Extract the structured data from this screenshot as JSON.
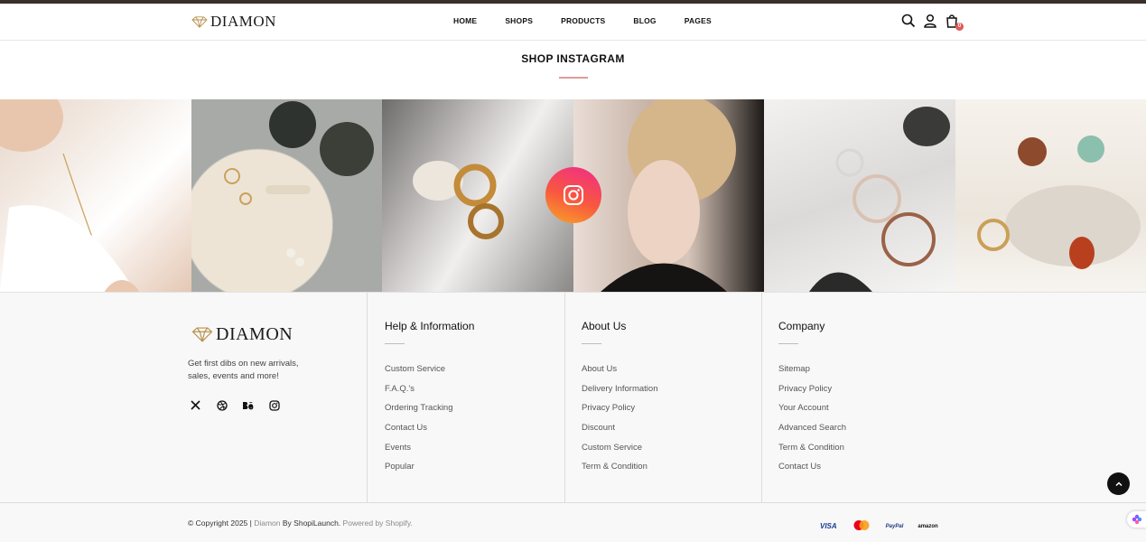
{
  "brand": {
    "name": "DIAMON"
  },
  "nav": {
    "items": [
      "HOME",
      "SHOPS",
      "PRODUCTS",
      "BLOG",
      "PAGES"
    ]
  },
  "header": {
    "cart_count": "0",
    "icons": [
      "search-icon",
      "user-icon",
      "shopping-bag-icon"
    ]
  },
  "instagram": {
    "title": "SHOP INSTAGRAM",
    "icon": "instagram-icon"
  },
  "footer": {
    "tagline": "Get first dibs on new arrivals, sales, events and more!",
    "socials": [
      "x-icon",
      "dribbble-icon",
      "behance-icon",
      "instagram-icon"
    ],
    "columns": [
      {
        "title": "Help & Information",
        "links": [
          "Custom Service",
          "F.A.Q.'s",
          "Ordering Tracking",
          "Contact Us",
          "Events",
          "Popular"
        ]
      },
      {
        "title": "About Us",
        "links": [
          "About Us",
          "Delivery Information",
          "Privacy Policy",
          "Discount",
          "Custom Service",
          "Term & Condition"
        ]
      },
      {
        "title": "Company",
        "links": [
          "Sitemap",
          "Privacy Policy",
          "Your Account",
          "Advanced Search",
          "Term & Condition",
          "Contact Us"
        ]
      }
    ],
    "copyright": {
      "prefix": "© Copyright 2025 |",
      "brand": "Diamon",
      "by": "By ShopiLaunch.",
      "powered": "Powered by Shopify."
    },
    "payments": [
      "VISA",
      "mastercard",
      "PayPal",
      "amazon"
    ]
  },
  "colors": {
    "accent_line": "#e29a9a",
    "topbar": "#3a2f2b",
    "badge": "#e35959"
  }
}
